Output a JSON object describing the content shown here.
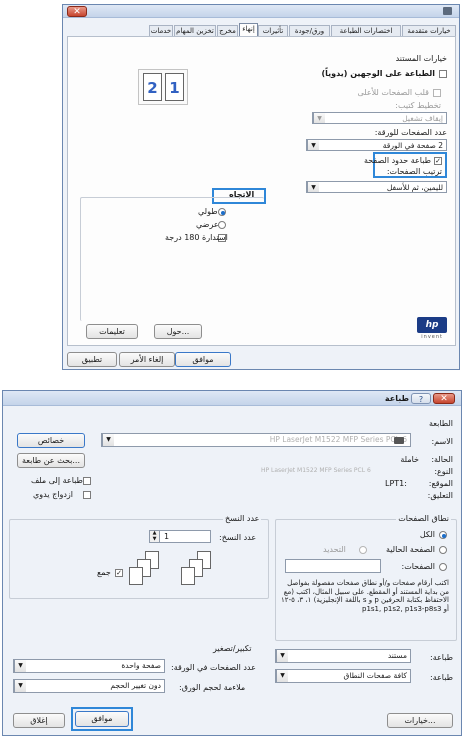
{
  "top_dialog": {
    "tabs": [
      "خيارات متقدمة",
      "اختصارات الطباعة",
      "ورق/جودة",
      "تأثيرات",
      "إنهاء",
      "مخرج",
      "تخزين المهام",
      "خدمات"
    ],
    "doc_options_title": "خيارات المستند",
    "print_both_sides": "الطباعة على الوجهين (يدوياً)",
    "flip_pages_up": "قلب الصفحات للأعلى",
    "booklet_layout_label": "تخطيط كتيب:",
    "booklet_layout_value": "إيقاف تشغيل",
    "pages_per_sheet_label": "عدد الصفحات للورقة:",
    "pages_per_sheet_value": "2 صفحة في الورقة",
    "print_page_borders": "طباعة حدود الصفحة",
    "page_order_label": "ترتيب الصفحات:",
    "page_order_value": "لليمين، ثم للأسفل",
    "orientation_title": "الاتجاه",
    "portrait": "طولي",
    "landscape": "عرضي",
    "rotate_180": "استدارة 180 درجة",
    "preview_pages": [
      "1",
      "2"
    ],
    "about_button": "حول...",
    "help_button": "تعليمات",
    "ok_button": "موافق",
    "cancel_button": "إلغاء الأمر",
    "apply_button": "تطبيق",
    "logo_text": "hp",
    "logo_sub": "invent"
  },
  "print_dialog": {
    "title": "طباعة",
    "help_icon": "?",
    "printer_section": "الطابعة",
    "name_label": "الاسم:",
    "name_value": "HP LaserJet M1522 MFP Series PCL 6",
    "properties_button": "خصائص",
    "find_printer_button": "بحث عن طابعة...",
    "status_label": "الحالة:",
    "status_value": "خاملة",
    "type_label": "النوع:",
    "type_value": "HP LaserJet M1522 MFP Series PCL 6",
    "where_label": "الموقع:",
    "where_value": "LPT1:",
    "comment_label": "التعليق:",
    "print_to_file": "طباعة إلى ملف",
    "manual_duplex": "ازدواج يدوي",
    "page_range_title": "نطاق الصفحات",
    "all": "الكل",
    "current_page": "الصفحة الحالية",
    "selection": "التحديد",
    "pages": "الصفحات:",
    "pages_help": "اكتب أرقام صفحات و/أو نطاق صفحات مفصولة بفواصل من بداية المستند أو المقطع. على سبيل المثال، اكتب (مع الاحتفاظ بكتابة الحرفين p و s باللغة الإنجليزية) ١، ٣، ٥-١٢ أو p1s1, p1s2, p1s3-p8s3",
    "copies_title": "عدد النسخ",
    "copies_label": "عدد النسخ:",
    "copies_value": "1",
    "collate": "جمع",
    "print_what_label": "طباعة:",
    "print_what_value": "مستند",
    "print_label": "طباعة:",
    "print_value": "كافة صفحات النطاق",
    "zoom_title": "تكبير/تصغير",
    "pages_per_sheet_label": "عدد الصفحات في الورقة:",
    "pages_per_sheet_value": "صفحة واحدة",
    "scale_label": "ملاءمة لحجم الورق:",
    "scale_value": "دون تغيير الحجم",
    "options_button": "خيارات...",
    "ok_button": "موافق",
    "cancel_button": "إغلاق"
  }
}
